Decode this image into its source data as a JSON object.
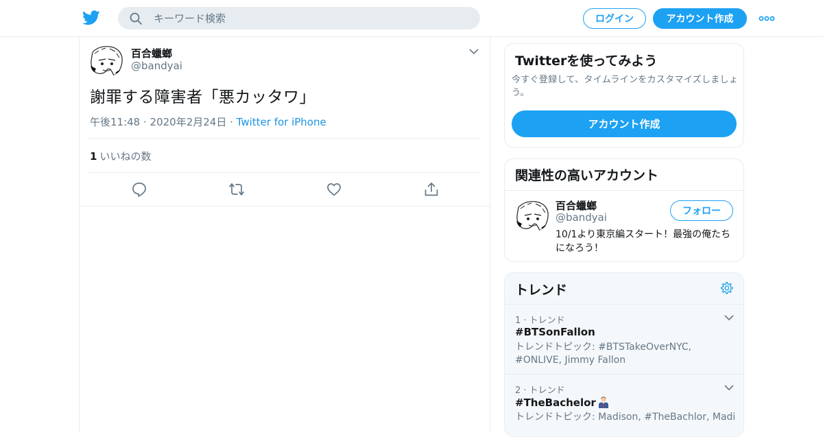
{
  "header": {
    "search_placeholder": "キーワード検索",
    "login_label": "ログイン",
    "signup_label": "アカウント作成"
  },
  "tweet": {
    "display_name": "百合蠟螂",
    "screen_name": "@bandyai",
    "text": "謝罪する障害者「悪カッタワ」",
    "time": "午後11:48 · 2020年2月24日 · ",
    "source": "Twitter for iPhone",
    "like_count": "1",
    "like_label": "いいねの数"
  },
  "sidebar": {
    "signup_card": {
      "title": "Twitterを使ってみよう",
      "description": "今すぐ登録して、タイムラインをカスタマイズしましょう。",
      "button_label": "アカウント作成"
    },
    "related": {
      "title": "関連性の高いアカウント",
      "name": "百合蠟螂",
      "handle": "@bandyai",
      "follow_label": "フォロー",
      "bio": "10/1より東京編スタート！最強の俺たちになろう！"
    },
    "trends": {
      "title": "トレンド",
      "items": [
        {
          "rank": "1 · トレンド",
          "name": "#BTSonFallon",
          "description": "トレンドトピック: #BTSTakeOverNYC, #ONLIVE, Jimmy Fallon"
        },
        {
          "rank": "2 · トレンド",
          "name": "#TheBachelor",
          "description": "トレンドトピック: Madison, #TheBachlor, Madi"
        }
      ]
    }
  },
  "colors": {
    "accent": "#1da1f2",
    "link": "#1b95e0",
    "secondary_text": "#657786",
    "border": "#e6ecf0"
  },
  "icons": [
    "twitter-bird-icon",
    "search-icon",
    "more-icon",
    "chevron-down-icon",
    "reply-icon",
    "retweet-icon",
    "like-icon",
    "share-icon",
    "gear-icon",
    "man-office-worker-emoji"
  ]
}
